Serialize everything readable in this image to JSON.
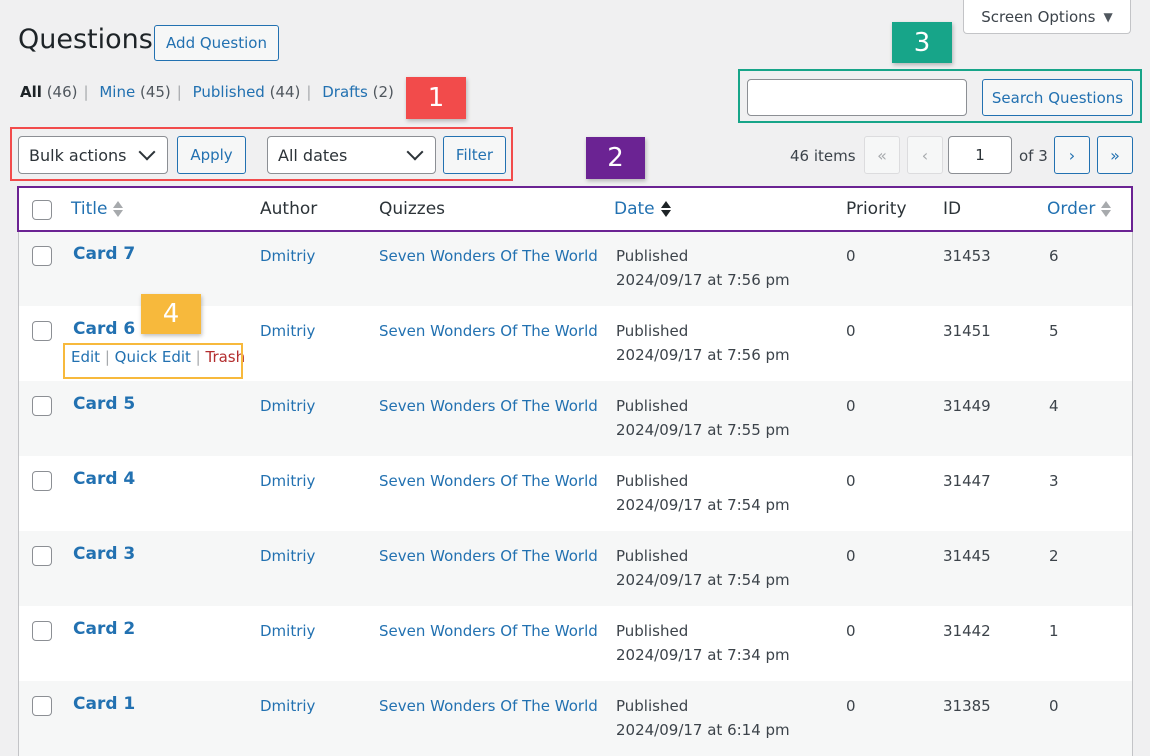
{
  "screen_options": {
    "label": "Screen Options"
  },
  "page": {
    "title": "Questions",
    "add_button": "Add Question"
  },
  "views": [
    {
      "label": "All",
      "count": "(46)"
    },
    {
      "label": "Mine",
      "count": "(45)"
    },
    {
      "label": "Published",
      "count": "(44)"
    },
    {
      "label": "Drafts",
      "count": "(2)"
    }
  ],
  "annotations": [
    "1",
    "2",
    "3",
    "4"
  ],
  "annotation_colors": {
    "1": "#f24b4b",
    "2": "#6b2393",
    "3": "#17a589",
    "4": "#f7b93c"
  },
  "toolbar": {
    "bulk_actions": "Bulk actions",
    "apply": "Apply",
    "dates": "All dates",
    "filter": "Filter"
  },
  "search": {
    "value": "",
    "button": "Search Questions"
  },
  "pagination": {
    "items": "46 items",
    "first": "«",
    "prev": "‹",
    "current": "1",
    "of": "of 3",
    "next": "›",
    "last": "»"
  },
  "columns": {
    "title": "Title",
    "author": "Author",
    "quizzes": "Quizzes",
    "date": "Date",
    "priority": "Priority",
    "id": "ID",
    "order": "Order"
  },
  "row_actions": {
    "edit": "Edit",
    "quick_edit": "Quick Edit",
    "trash": "Trash"
  },
  "rows": [
    {
      "title": "Card 7",
      "author": "Dmitriy",
      "quiz": "Seven Wonders Of The World",
      "status": "Published",
      "date": "2024/09/17 at 7:56 pm",
      "priority": "0",
      "id": "31453",
      "order": "6"
    },
    {
      "title": "Card 6",
      "author": "Dmitriy",
      "quiz": "Seven Wonders Of The World",
      "status": "Published",
      "date": "2024/09/17 at 7:56 pm",
      "priority": "0",
      "id": "31451",
      "order": "5"
    },
    {
      "title": "Card 5",
      "author": "Dmitriy",
      "quiz": "Seven Wonders Of The World",
      "status": "Published",
      "date": "2024/09/17 at 7:55 pm",
      "priority": "0",
      "id": "31449",
      "order": "4"
    },
    {
      "title": "Card 4",
      "author": "Dmitriy",
      "quiz": "Seven Wonders Of The World",
      "status": "Published",
      "date": "2024/09/17 at 7:54 pm",
      "priority": "0",
      "id": "31447",
      "order": "3"
    },
    {
      "title": "Card 3",
      "author": "Dmitriy",
      "quiz": "Seven Wonders Of The World",
      "status": "Published",
      "date": "2024/09/17 at 7:54 pm",
      "priority": "0",
      "id": "31445",
      "order": "2"
    },
    {
      "title": "Card 2",
      "author": "Dmitriy",
      "quiz": "Seven Wonders Of The World",
      "status": "Published",
      "date": "2024/09/17 at 7:34 pm",
      "priority": "0",
      "id": "31442",
      "order": "1"
    },
    {
      "title": "Card 1",
      "author": "Dmitriy",
      "quiz": "Seven Wonders Of The World",
      "status": "Published",
      "date": "2024/09/17 at 6:14 pm",
      "priority": "0",
      "id": "31385",
      "order": "0"
    }
  ]
}
